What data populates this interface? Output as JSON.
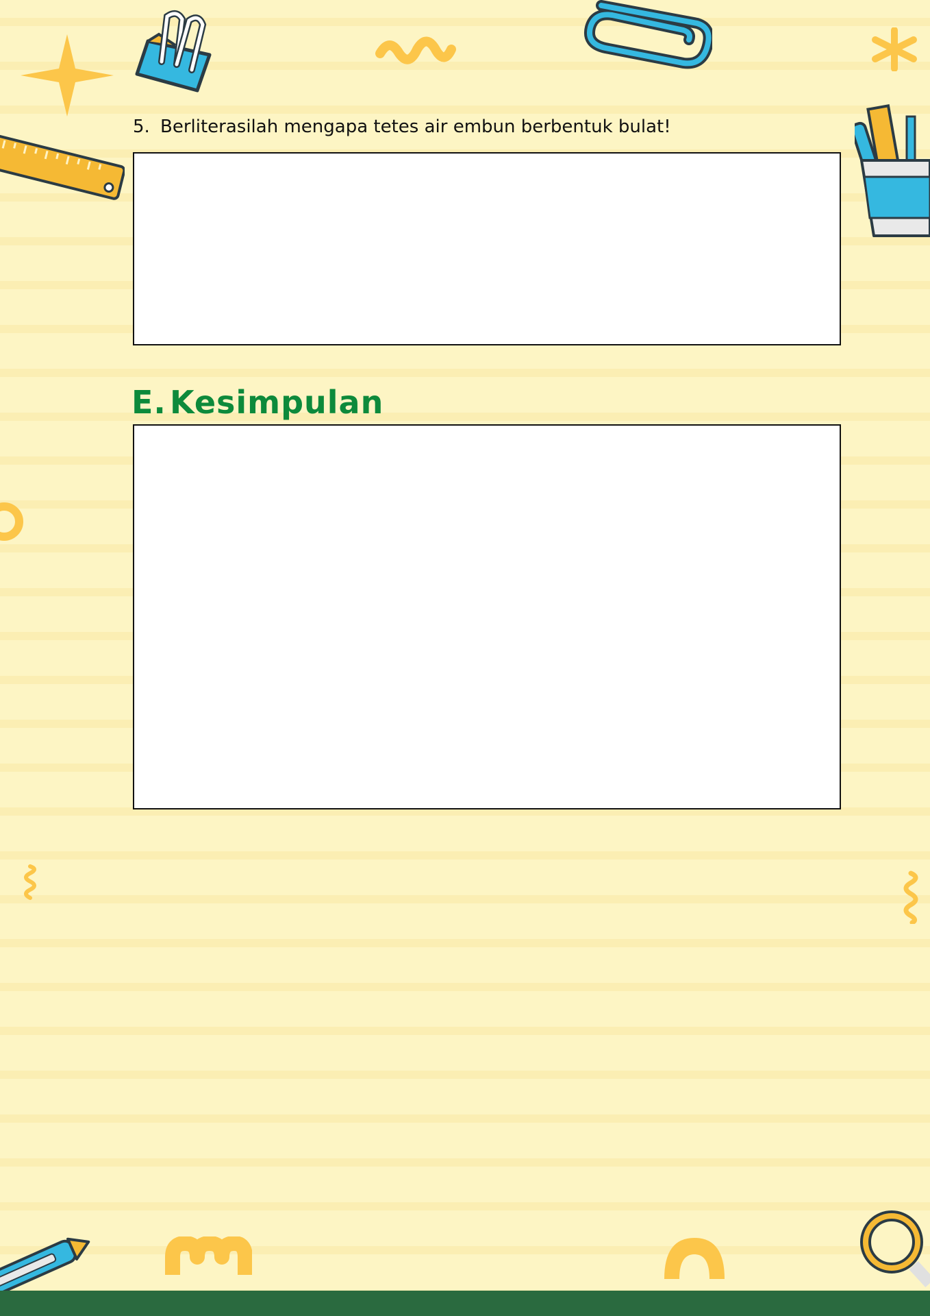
{
  "question": {
    "number": "5.",
    "text": "Berliterasilah mengapa tetes air embun berbentuk bulat!"
  },
  "section": {
    "letter": "E.",
    "title": "Kesimpulan"
  },
  "colors": {
    "background": "#fdf5c4",
    "heading": "#0d8a3b",
    "footer": "#2a6a3f",
    "accent_yellow": "#fcc64a",
    "accent_blue": "#35b8e0"
  },
  "decorations": [
    "star-icon",
    "binder-clip-icon",
    "squiggle-icon",
    "paper-clip-icon",
    "asterisk-icon",
    "ruler-icon",
    "pencil-cup-icon",
    "ring-icon",
    "spiral-icon",
    "pencil-icon",
    "wave-icon",
    "arch-icon",
    "magnifier-icon"
  ]
}
